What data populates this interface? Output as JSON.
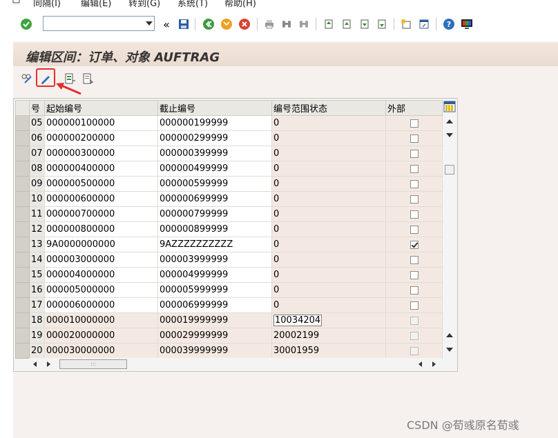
{
  "menubar": {
    "items": [
      "同隔(I)",
      "编辑(E)",
      "转到(G)",
      "系统(T)",
      "帮助(H)"
    ]
  },
  "toolbar": {
    "command_field_value": "",
    "icons": [
      "ok-check-icon",
      "save-icon",
      "back-icon",
      "exit-icon",
      "cancel-icon",
      "print-icon",
      "find-icon",
      "find-next-icon",
      "first-page-icon",
      "prev-page-icon",
      "next-page-icon",
      "last-page-icon",
      "new-session-icon",
      "shortcut-icon",
      "help-icon",
      "customize-layout-icon"
    ]
  },
  "screen": {
    "title": "编辑区间：订单、对象 AUFTRAG"
  },
  "app_toolbar": {
    "icons": [
      "display-change-icon",
      "edit-pencil-icon",
      "interval-icon",
      "status-icon"
    ]
  },
  "table": {
    "columns": [
      "号",
      "起始编号",
      "截止编号",
      "编号范围状态",
      "外部"
    ],
    "rows": [
      {
        "no": "05",
        "from": "000000100000",
        "to": "000000199999",
        "status": "0",
        "ext": false,
        "editable": true
      },
      {
        "no": "06",
        "from": "000000200000",
        "to": "000000299999",
        "status": "0",
        "ext": false,
        "editable": true
      },
      {
        "no": "07",
        "from": "000000300000",
        "to": "000000399999",
        "status": "0",
        "ext": false,
        "editable": true
      },
      {
        "no": "08",
        "from": "000000400000",
        "to": "000000499999",
        "status": "0",
        "ext": false,
        "editable": true
      },
      {
        "no": "09",
        "from": "000000500000",
        "to": "000000599999",
        "status": "0",
        "ext": false,
        "editable": true
      },
      {
        "no": "10",
        "from": "000000600000",
        "to": "000000699999",
        "status": "0",
        "ext": false,
        "editable": true
      },
      {
        "no": "11",
        "from": "000000700000",
        "to": "000000799999",
        "status": "0",
        "ext": false,
        "editable": true
      },
      {
        "no": "12",
        "from": "000000800000",
        "to": "000000899999",
        "status": "0",
        "ext": false,
        "editable": true
      },
      {
        "no": "13",
        "from": "9A0000000000",
        "to": "9AZZZZZZZZZZ",
        "status": "0",
        "ext": true,
        "editable": true
      },
      {
        "no": "14",
        "from": "000003000000",
        "to": "000003999999",
        "status": "0",
        "ext": false,
        "editable": true
      },
      {
        "no": "15",
        "from": "000004000000",
        "to": "000004999999",
        "status": "0",
        "ext": false,
        "editable": true
      },
      {
        "no": "16",
        "from": "000005000000",
        "to": "000005999999",
        "status": "0",
        "ext": false,
        "editable": true
      },
      {
        "no": "17",
        "from": "000006000000",
        "to": "000006999999",
        "status": "0",
        "ext": false,
        "editable": true
      },
      {
        "no": "18",
        "from": "000010000000",
        "to": "000019999999",
        "status": "10034204",
        "ext": false,
        "editable": false
      },
      {
        "no": "19",
        "from": "000020000000",
        "to": "000029999999",
        "status": "20002199",
        "ext": false,
        "editable": false
      },
      {
        "no": "20",
        "from": "000030000000",
        "to": "000039999999",
        "status": "30001959",
        "ext": false,
        "editable": false
      }
    ]
  },
  "scrollbar": {
    "thumb_grip": ":::"
  },
  "watermark": "CSDN @荀彧原名荀彧",
  "colors": {
    "highlight_box": "#e52d2d",
    "title_bg": "#eadbd0",
    "readonly_cell": "#f4e9e2"
  }
}
